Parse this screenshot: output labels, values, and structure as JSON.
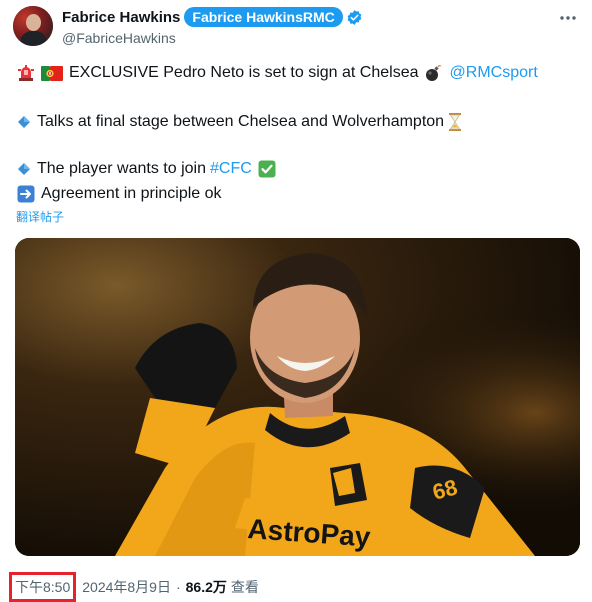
{
  "author": {
    "name": "Fabrice Hawkins",
    "affiliate_label": "Fabrice HawkinsRMC",
    "handle": "@FabriceHawkins",
    "verified": true
  },
  "tweet": {
    "line1_text": "EXCLUSIVE Pedro Neto is set to sign at Chelsea",
    "line1_mention": "@RMCsport",
    "line2_text": "Talks at final stage between Chelsea and Wolverhampton",
    "line3_text": "The player wants to join",
    "line3_hashtag": "#CFC",
    "line4_text": "Agreement in principle ok",
    "translate_label": "翻译帖子"
  },
  "photo": {
    "sponsor_text": "AstroPay",
    "shirt_number": "68"
  },
  "footer": {
    "time": "下午8:50",
    "date": "2024年8月9日",
    "separator": "·",
    "views_count": "86.2万",
    "views_label": "查看"
  },
  "colors": {
    "accent": "#1d9bf0",
    "highlight_border": "#e6232a",
    "wolves_gold": "#f2a71b"
  },
  "icons": [
    "siren-icon",
    "portugal-flag-icon",
    "bomb-icon",
    "diamond-icon",
    "hourglass-icon",
    "check-mark-icon",
    "right-arrow-icon",
    "verified-badge-icon",
    "more-options-icon"
  ]
}
